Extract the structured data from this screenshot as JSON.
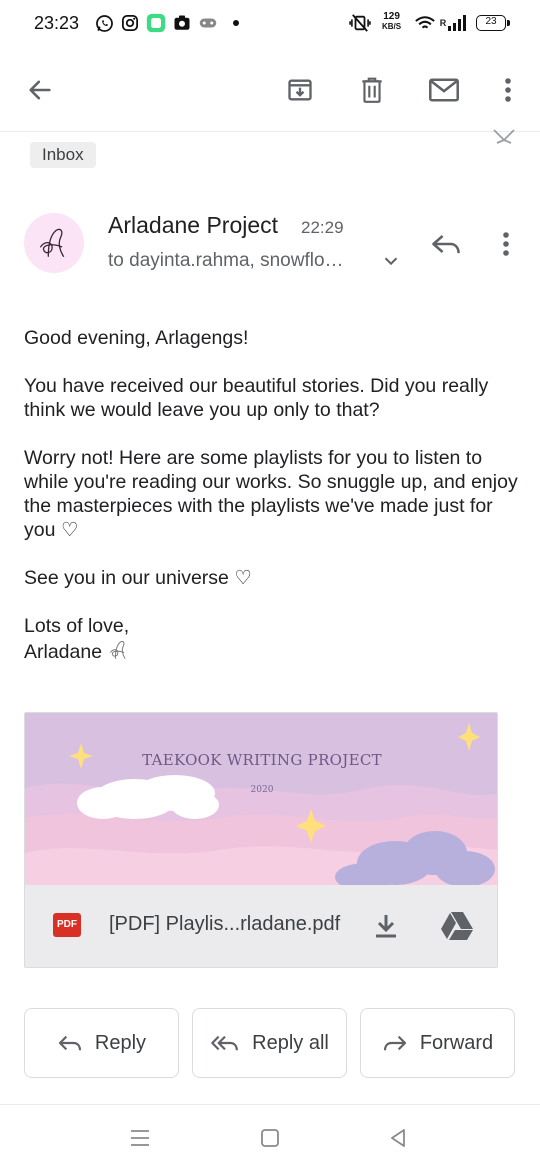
{
  "status_bar": {
    "time": "23:23",
    "net_speed_value": "129",
    "net_speed_unit": "KB/S",
    "signal_label": "R",
    "battery": "23"
  },
  "toolbar": {
    "back": "arrow-back-icon",
    "archive": "archive-icon",
    "delete": "delete-icon",
    "mark_unread": "mail-icon",
    "more": "more-vert-icon"
  },
  "label": "Inbox",
  "email": {
    "sender": "Arladane Project",
    "time": "22:29",
    "recipients": "to dayinta.rahma, snowflo…",
    "body": {
      "greeting": "Good evening, Arlagengs!",
      "p1": "You have received our beautiful stories. Did you really think we would leave you up only to that?",
      "p2": "Worry not! Here are some playlists for you to listen to while you're reading our works. So snuggle up, and enjoy the masterpieces with the playlists we've made just for you ♡",
      "p3": "See you in our universe ♡",
      "closing": "Lots of love,",
      "signature": "Arladane"
    }
  },
  "attachment": {
    "thumb_title": "TAEKOOK WRITING PROJECT",
    "thumb_year": "2020",
    "type_badge": "PDF",
    "filename": "[PDF] Playlis...rladane.pdf"
  },
  "actions": {
    "reply": "Reply",
    "reply_all": "Reply all",
    "forward": "Forward"
  },
  "colors": {
    "pdf_red": "#d93025",
    "avatar_bg": "#fbe4f6",
    "thumb_purple": "#d8bfe0",
    "thumb_pink": "#f2c2da"
  }
}
